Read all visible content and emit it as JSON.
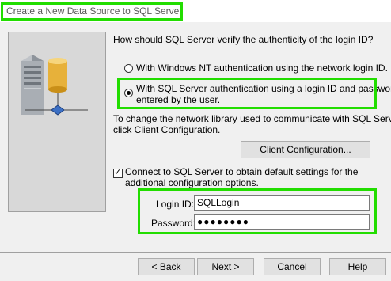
{
  "window": {
    "title": "Create a New Data Source to SQL Server"
  },
  "dialog": {
    "question": "How should SQL Server verify the authenticity of the login ID?",
    "auth_options": [
      {
        "label": "With Windows NT authentication using the network login ID.",
        "selected": false
      },
      {
        "label_line1": "With SQL Server authentication using a login ID and password",
        "label_line2": "entered by the user.",
        "selected": true
      }
    ],
    "network_info_line1": "To change the network library used to communicate with SQL Server,",
    "network_info_line2": "click Client Configuration.",
    "client_config_button": "Client Configuration...",
    "connect_checkbox": {
      "checked": true,
      "line1": "Connect to SQL Server to obtain default settings for the",
      "line2": "additional configuration options."
    },
    "login_id": {
      "label": "Login ID:",
      "value": "SQLLogin"
    },
    "password": {
      "label": "Password:",
      "value": "●●●●●●●●"
    }
  },
  "footer": {
    "back": "< Back",
    "next": "Next >",
    "cancel": "Cancel",
    "help": "Help"
  },
  "colors": {
    "highlight": "#22dd00",
    "dialog_bg": "#f0f0f0",
    "button_bg": "#e1e1e1"
  },
  "icons": [
    "server-database-icon"
  ]
}
